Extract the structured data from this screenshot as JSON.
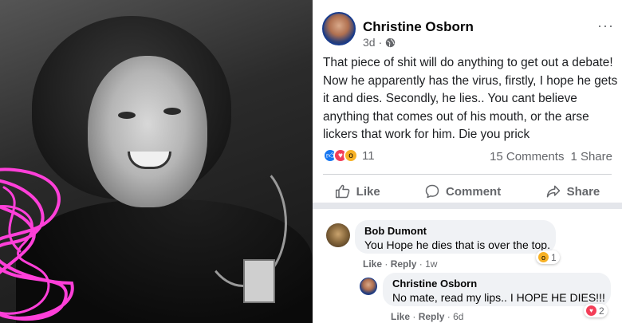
{
  "post": {
    "author": "Christine Osborn",
    "time": "3d",
    "more": "···",
    "text": "That piece of shit will do anything to get out a debate!  Now he apparently has the virus, firstly, I hope he gets it and dies. Secondly, he lies.. You cant believe anything that comes out of his mouth, or the arse lickers that work for him.  Die you prick",
    "reaction_count": "11",
    "comments_count": "15 Comments",
    "shares_count": "1 Share",
    "actions": {
      "like": "Like",
      "comment": "Comment",
      "share": "Share"
    }
  },
  "comments": [
    {
      "author": "Bob Dumont",
      "text": "You Hope he dies that is over the top.",
      "like": "Like",
      "reply": "Reply",
      "time": "1w",
      "reaction_count": "1"
    },
    {
      "author": "Christine Osborn",
      "text": "No mate, read my lips.. I HOPE HE DIES!!!",
      "like": "Like",
      "reply": "Reply",
      "time": "6d",
      "reaction_count": "2"
    }
  ],
  "colors": {
    "facebook_blue": "#1877f2",
    "love_red": "#f33e58",
    "wow_yellow": "#f7b125",
    "scribble_pink": "#ff3fd9"
  }
}
